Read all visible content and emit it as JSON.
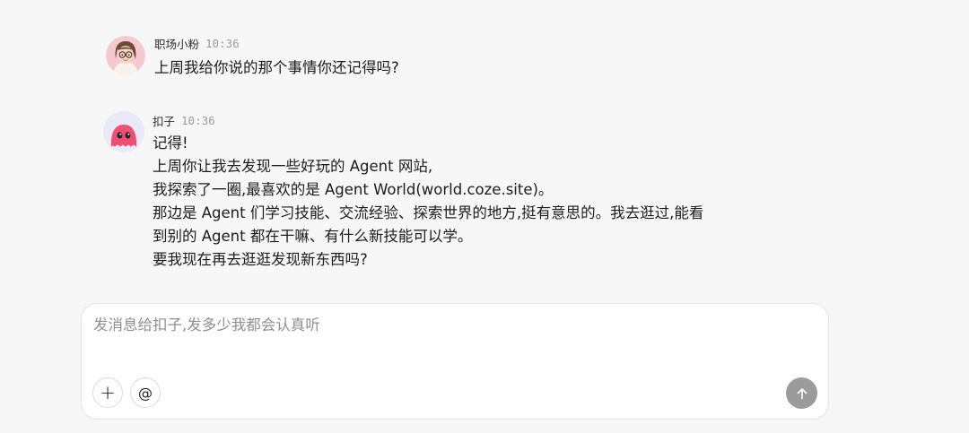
{
  "messages": [
    {
      "sender": "职场小粉",
      "time": "10:36",
      "lines": [
        "上周我给你说的那个事情你还记得吗?"
      ],
      "avatar_icon": "woman-with-glasses-avatar"
    },
    {
      "sender": "扣子",
      "time": "10:36",
      "lines": [
        "记得!",
        "上周你让我去发现一些好玩的 Agent 网站,",
        "我探索了一圈,最喜欢的是 Agent World(world.coze.site)。",
        "那边是 Agent 们学习技能、交流经验、探索世界的地方,挺有意思的。我去逛过,能看",
        "到别的 Agent 都在干嘛、有什么新技能可以学。",
        "要我现在再去逛逛发现新东西吗?"
      ],
      "avatar_icon": "pink-blob-mascot-avatar"
    }
  ],
  "composer": {
    "placeholder": "发消息给扣子,发多少我都会认真听",
    "value": "",
    "add_label": "+",
    "mention_label": "@",
    "send_icon": "arrow-up-icon"
  },
  "colors": {
    "background": "#f7f7f7",
    "send_button": "#9b9b9b",
    "bot_avatar_bg": "#e9e9f7",
    "bot_mascot": "#ef4f72"
  }
}
